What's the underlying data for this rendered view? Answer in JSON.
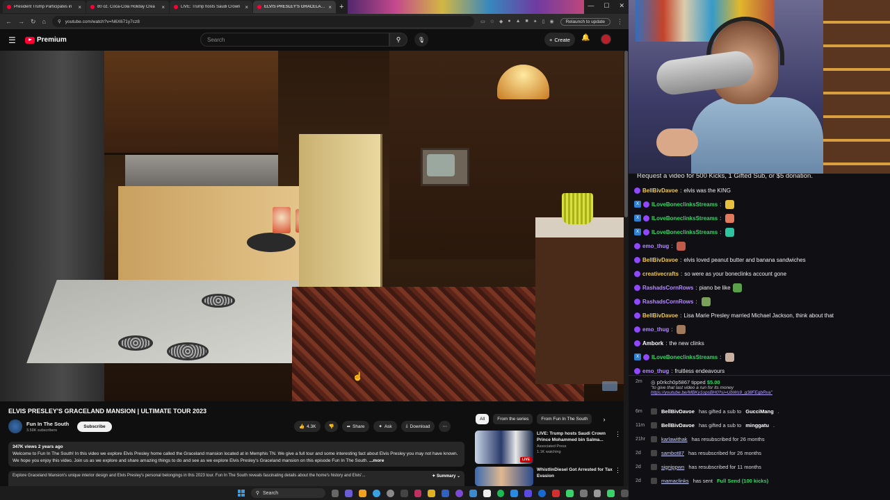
{
  "browser": {
    "tabs": [
      {
        "label": "President Trump Participates in"
      },
      {
        "label": "80 oz. Coca-Cola Holiday Crea"
      },
      {
        "label": "LIVE: Trump hosts Saudi Crown"
      },
      {
        "label": "ELVIS PRESLEY'S GRACELAND I"
      }
    ],
    "new_tab": "+",
    "url": "youtube.com/watch?v=N6X671y7cz8",
    "relaunch": "Relaunch to update"
  },
  "youtube": {
    "brand": "Premium",
    "search_placeholder": "Search",
    "create_label": "Create"
  },
  "video": {
    "title": "ELVIS PRESLEY'S GRACELAND MANSION | ULTIMATE TOUR 2023",
    "channel": "Fun In The South",
    "subscribers": "3.59K subscribers",
    "subscribe": "Subscribe",
    "likes": "4.3K",
    "share": "Share",
    "ask": "Ask",
    "download": "Download",
    "meta": "347K views  2 years ago",
    "description": "Welcome to Fun In The South! In this video we explore Elvis Presley home called the Graceland mansion located at in Memphis TN. We give a full tour and some interesting fact about Elvis Presley you may not have known.  We hope you enjoy this video. Join us as we explore and share amazing things to do and see as we explore Elvis Presley's Graceland mansion  on this episode Fun In The South. ",
    "more": "...more",
    "ai_summary": "Explore Graceland Mansion's unique interior design and Elvis Presley's personal belongings in this 2023 tour. Fun In The South reveals fascinating details about the home's history and Elvis'...",
    "summary_label": "Summary"
  },
  "recommendations": {
    "chips": [
      "All",
      "From the series",
      "From Fun In The South"
    ],
    "items": [
      {
        "title": "LIVE: Trump hosts Saudi Crown Prince Mohammed bin Salma...",
        "channel": "Associated Press",
        "meta": "1.1K watching",
        "badge": "LIVE"
      },
      {
        "title": "WhistlinDiesel Got Arrested for Tax Evasion",
        "channel": "",
        "meta": "",
        "badge": ""
      }
    ]
  },
  "chat": {
    "promo": "Request a video for 500 Kicks, 1 Gifted Sub, or $5 donation.",
    "messages": [
      {
        "user": "BellBivDavoe",
        "color": "#f2c94c",
        "text": "elvis was the KING",
        "twitch": false,
        "emote": ""
      },
      {
        "user": "ILoveBoneclinksStreams",
        "color": "#3ad36a",
        "text": "",
        "twitch": true,
        "emote": "#e8c040"
      },
      {
        "user": "ILoveBoneclinksStreams",
        "color": "#3ad36a",
        "text": "",
        "twitch": true,
        "emote": "#e07a5a"
      },
      {
        "user": "ILoveBoneclinksStreams",
        "color": "#3ad36a",
        "text": "",
        "twitch": true,
        "emote": "#2ec4a0"
      },
      {
        "user": "emo_thug",
        "color": "#b48cff",
        "text": "",
        "twitch": false,
        "emote": "#c05a4a"
      },
      {
        "user": "BellBivDavoe",
        "color": "#f2c94c",
        "text": "elvis loved peanut butter and banana sandwiches",
        "twitch": false,
        "emote": ""
      },
      {
        "user": "creativecrafts",
        "color": "#f2c94c",
        "text": "so were as your boneclinks account gone",
        "twitch": false,
        "emote": ""
      },
      {
        "user": "RashadsCornRows",
        "color": "#b48cff",
        "text": "piano be like",
        "twitch": false,
        "emote": "#5aa04a"
      },
      {
        "user": "RashadsCornRows",
        "color": "#b48cff",
        "text": "",
        "twitch": false,
        "emote": "#7aa05a"
      },
      {
        "user": "BellBivDavoe",
        "color": "#f2c94c",
        "text": "Lisa Marie Presley married Michael Jackson, think about that",
        "twitch": false,
        "emote": ""
      },
      {
        "user": "emo_thug",
        "color": "#b48cff",
        "text": "",
        "twitch": false,
        "emote": "#a07a5a"
      },
      {
        "user": "Ambork",
        "color": "#ffffff",
        "text": "the new clinks",
        "twitch": false,
        "emote": ""
      },
      {
        "user": "ILoveBoneclinksStreams",
        "color": "#3ad36a",
        "text": "",
        "twitch": true,
        "emote": "#c8b0a0"
      },
      {
        "user": "emo_thug",
        "color": "#b48cff",
        "text": "fruitless endeavours",
        "twitch": false,
        "emote": ""
      }
    ],
    "tip": {
      "time": "2m",
      "user": "p0rkch0p5867",
      "action": "tipped",
      "amount": "$5.00",
      "quote": "\"to give that last video a run for its money",
      "link": "https://youtube.be/MBKy1opsBH0?si=UbWs9_g38FEgbRva\""
    },
    "events": [
      {
        "time": "6m",
        "user": "BellBivDavoe",
        "text": "has gifted a sub to",
        "target": "GucciMang",
        "style": "plain"
      },
      {
        "time": "11m",
        "user": "BellBivDavoe",
        "text": "has gifted a sub to",
        "target": "minggatu",
        "style": "plain"
      },
      {
        "time": "21hr",
        "user": "karlawithak",
        "text": "has resubscribed for 26 months",
        "target": "",
        "style": "link"
      },
      {
        "time": "2d",
        "user": "sambot87",
        "text": "has resubscribed for 26 months",
        "target": "",
        "style": "link"
      },
      {
        "time": "2d",
        "user": "signippwn",
        "text": "has resubscribed for 11 months",
        "target": "",
        "style": "link"
      },
      {
        "time": "2d",
        "user": "mamaclinks",
        "text": "has sent",
        "target": "Full Send (100 kicks)",
        "style": "green"
      }
    ]
  },
  "taskbar": {
    "search": "Search"
  },
  "colors": {
    "youtube_red": "#ff0033",
    "chat_bg": "#101014"
  }
}
